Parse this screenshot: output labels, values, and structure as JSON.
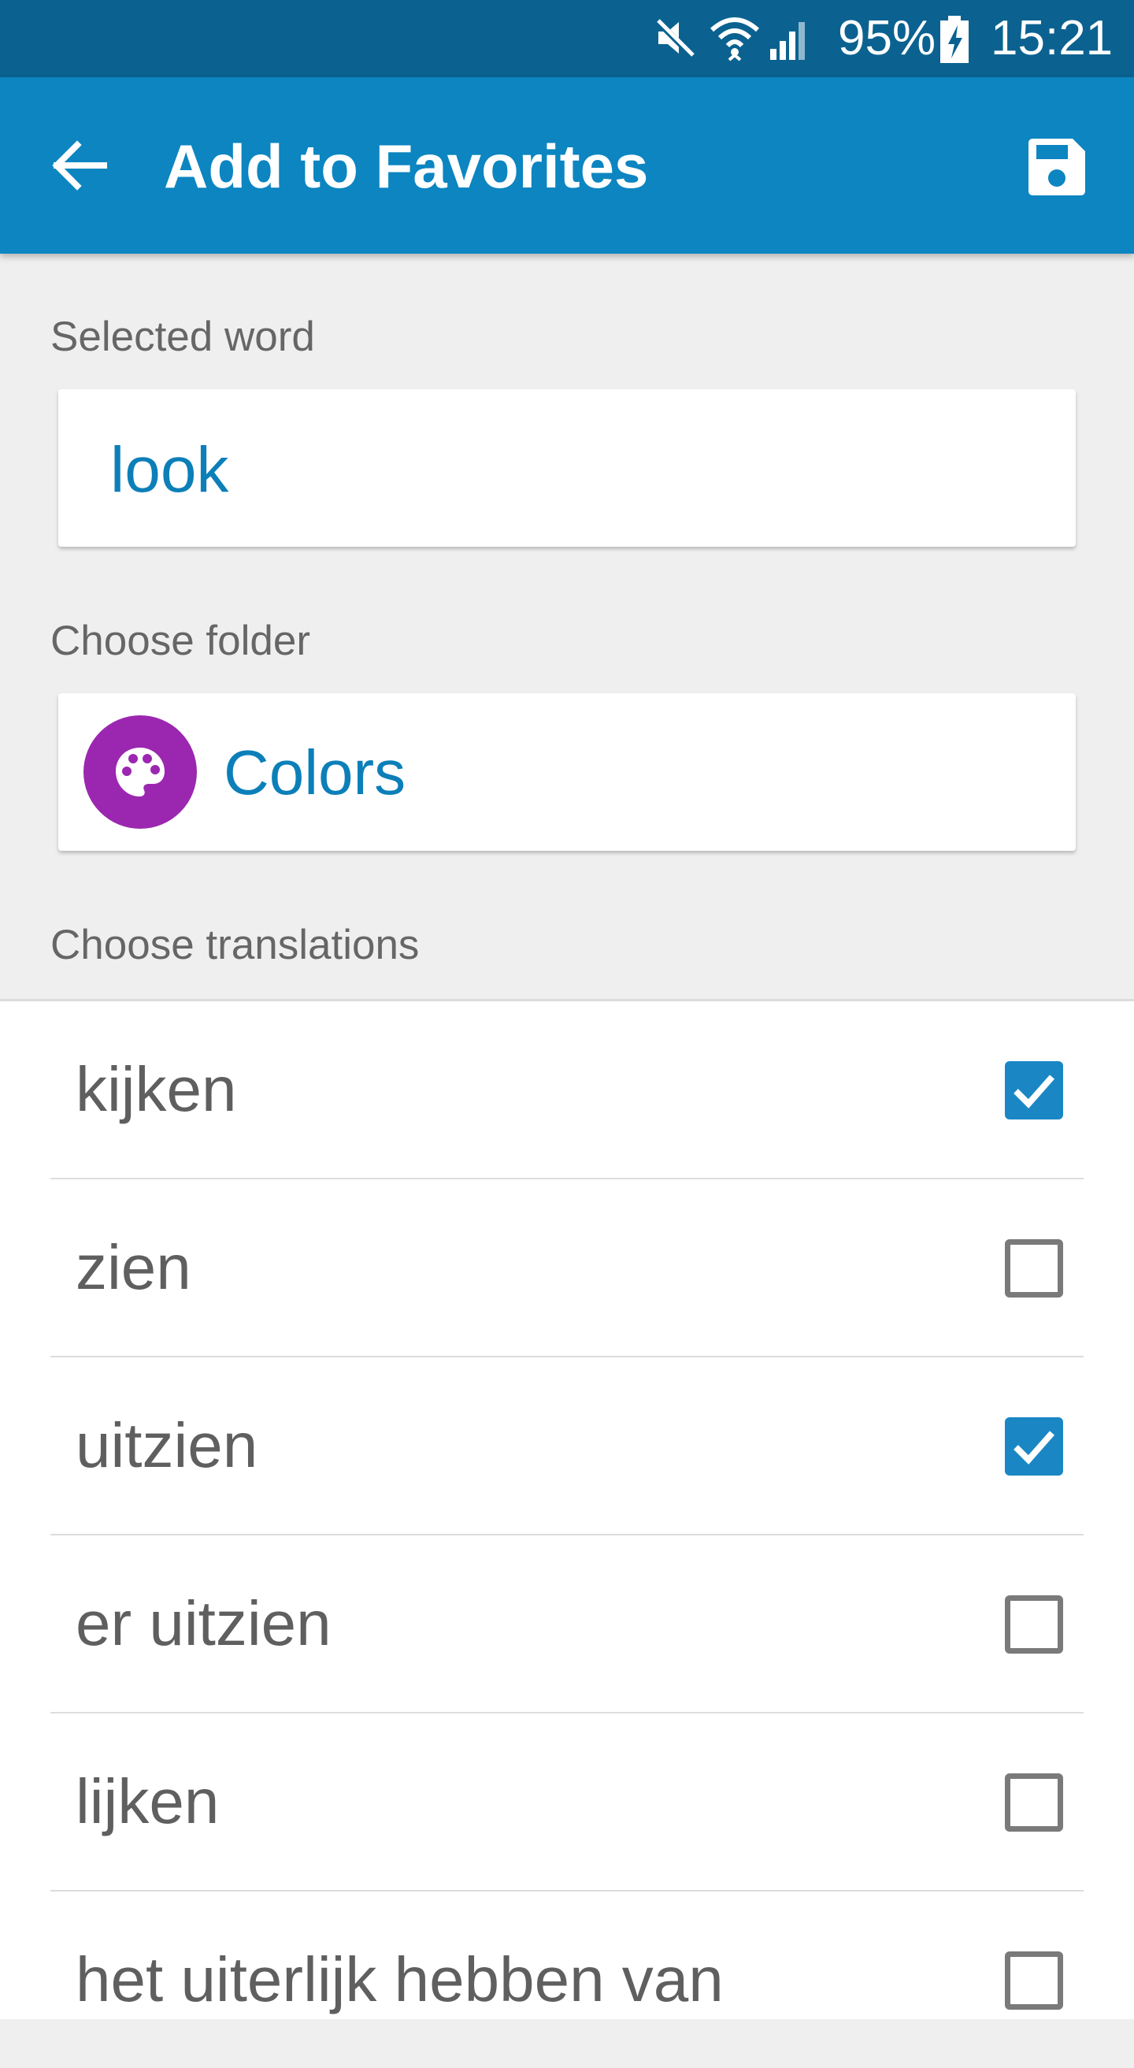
{
  "status_bar": {
    "battery": "95%",
    "time": "15:21",
    "icons": [
      "mute-icon",
      "wifi-icon",
      "signal-icon",
      "battery-charging-icon"
    ]
  },
  "app_bar": {
    "title": "Add to Favorites",
    "back_icon": "arrow-left-icon",
    "save_icon": "save-icon",
    "color": "#0c85c1"
  },
  "selected_word": {
    "label": "Selected word",
    "value": "look"
  },
  "folder": {
    "label": "Choose folder",
    "name": "Colors",
    "icon": "palette-icon",
    "icon_color": "#9b27b0"
  },
  "translations": {
    "label": "Choose translations",
    "items": [
      {
        "text": "kijken",
        "checked": true
      },
      {
        "text": "zien",
        "checked": false
      },
      {
        "text": "uitzien",
        "checked": true
      },
      {
        "text": "er uitzien",
        "checked": false
      },
      {
        "text": "lijken",
        "checked": false
      },
      {
        "text": "het uiterlijk hebben van",
        "checked": false
      }
    ]
  },
  "colors": {
    "accent": "#0c7fb9",
    "status_bar": "#0b6290",
    "checkbox_checked": "#1a87c4"
  }
}
